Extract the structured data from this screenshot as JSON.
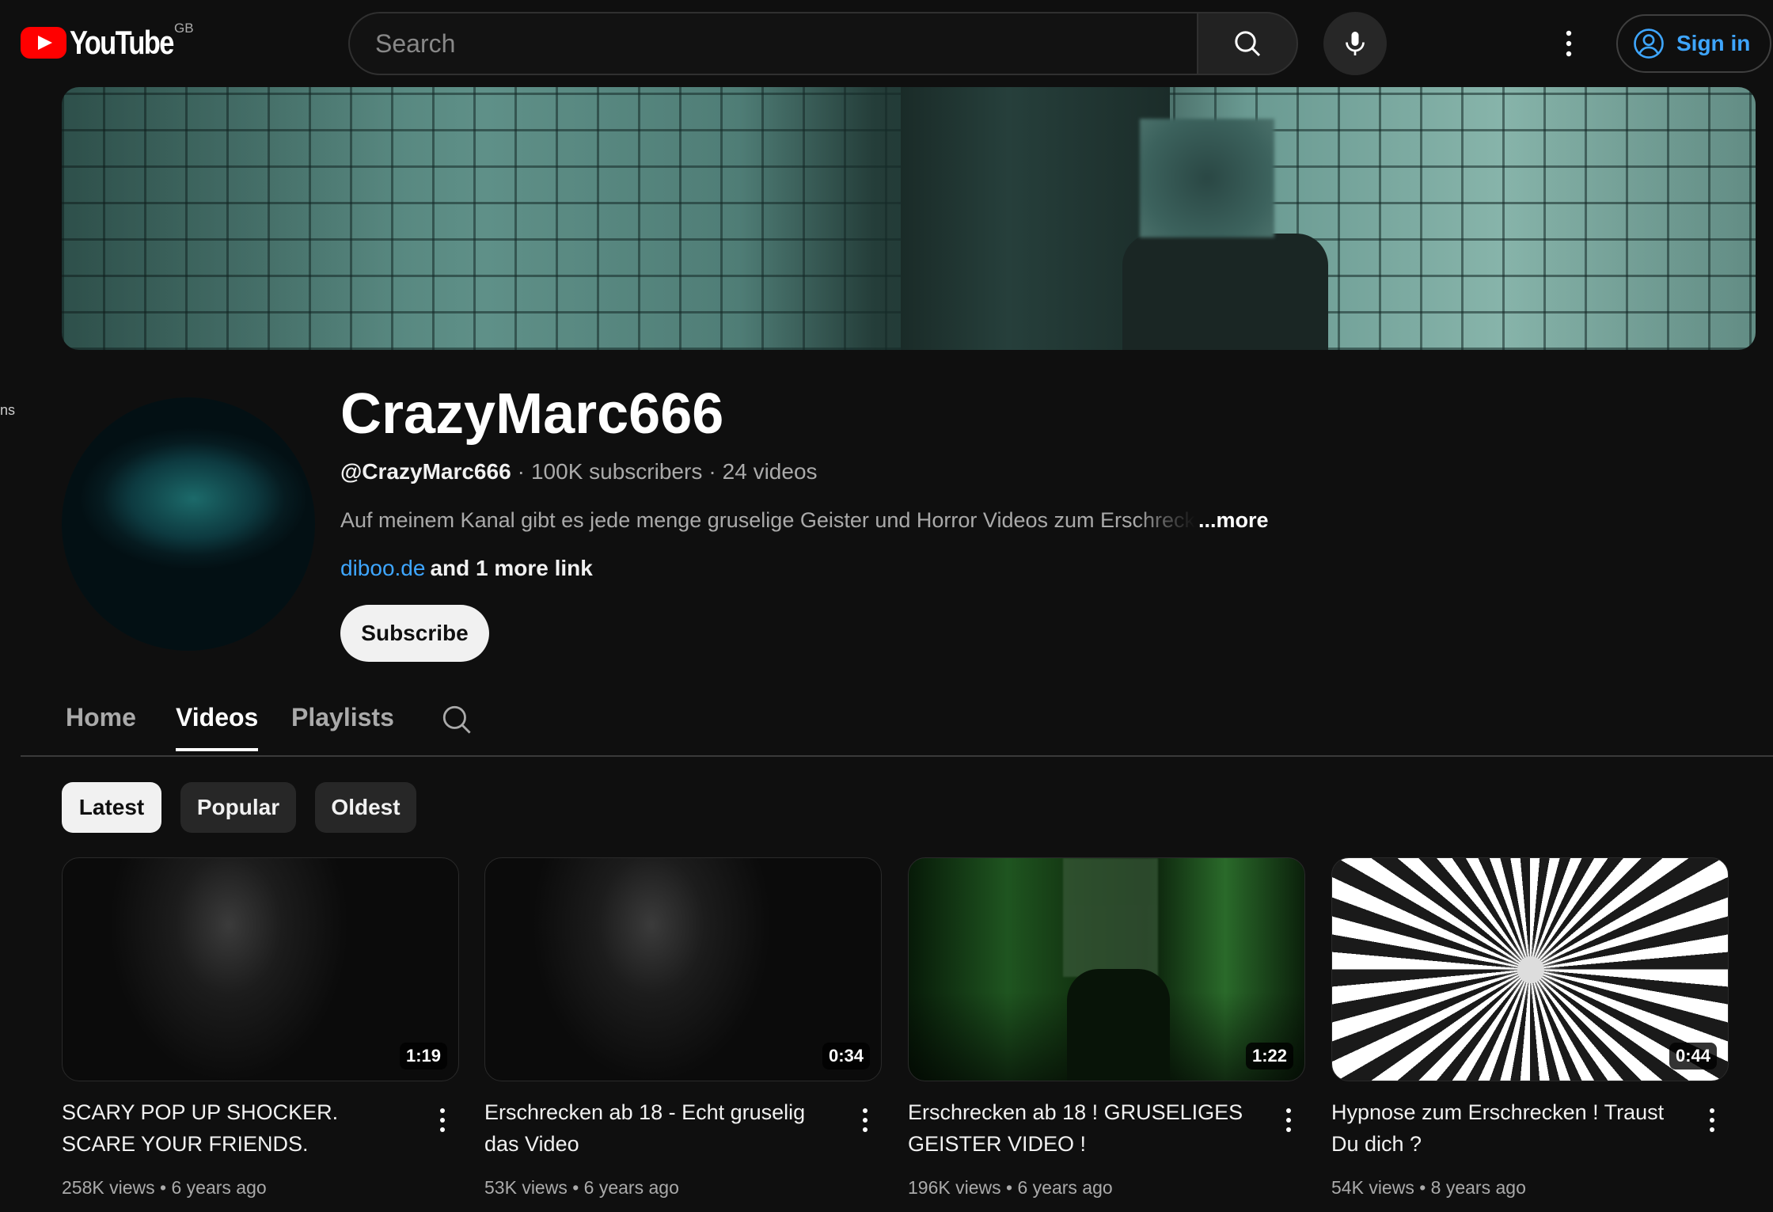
{
  "header": {
    "logo_text": "YouTube",
    "region": "GB",
    "search_placeholder": "Search",
    "sign_in_label": "Sign in"
  },
  "edge_fragment": "ns",
  "channel": {
    "name": "CrazyMarc666",
    "handle": "@CrazyMarc666",
    "subscribers": "100K subscribers",
    "videos_count": "24 videos",
    "description": "Auf meinem Kanal gibt es jede menge gruselige Geister und Horror Videos zum Erschreck",
    "description_more": "...more",
    "link": "diboo.de",
    "more_links": "and 1 more link",
    "subscribe_label": "Subscribe"
  },
  "tabs": [
    {
      "label": "Home",
      "active": false
    },
    {
      "label": "Videos",
      "active": true
    },
    {
      "label": "Playlists",
      "active": false
    }
  ],
  "chips": [
    {
      "label": "Latest",
      "active": true
    },
    {
      "label": "Popular",
      "active": false
    },
    {
      "label": "Oldest",
      "active": false
    }
  ],
  "videos": [
    {
      "title": "SCARY POP UP SHOCKER. SCARE YOUR FRIENDS.",
      "duration": "1:19",
      "views": "258K views",
      "age": "6 years ago"
    },
    {
      "title": "Erschrecken ab 18 - Echt gruselig das Video",
      "duration": "0:34",
      "views": "53K views",
      "age": "6 years ago"
    },
    {
      "title": "Erschrecken ab 18 ! GRUSELIGES GEISTER VIDEO !",
      "duration": "1:22",
      "views": "196K views",
      "age": "6 years ago"
    },
    {
      "title": "Hypnose zum Erschrecken ! Traust Du dich ?",
      "duration": "0:44",
      "views": "54K views",
      "age": "8 years ago"
    }
  ],
  "colors": {
    "background": "#0f0f0f",
    "brand_red": "#ff0000",
    "link_blue": "#3ea6ff"
  },
  "icons": [
    "youtube-logo-icon",
    "search-icon",
    "microphone-icon",
    "more-vertical-icon",
    "account-circle-icon"
  ]
}
